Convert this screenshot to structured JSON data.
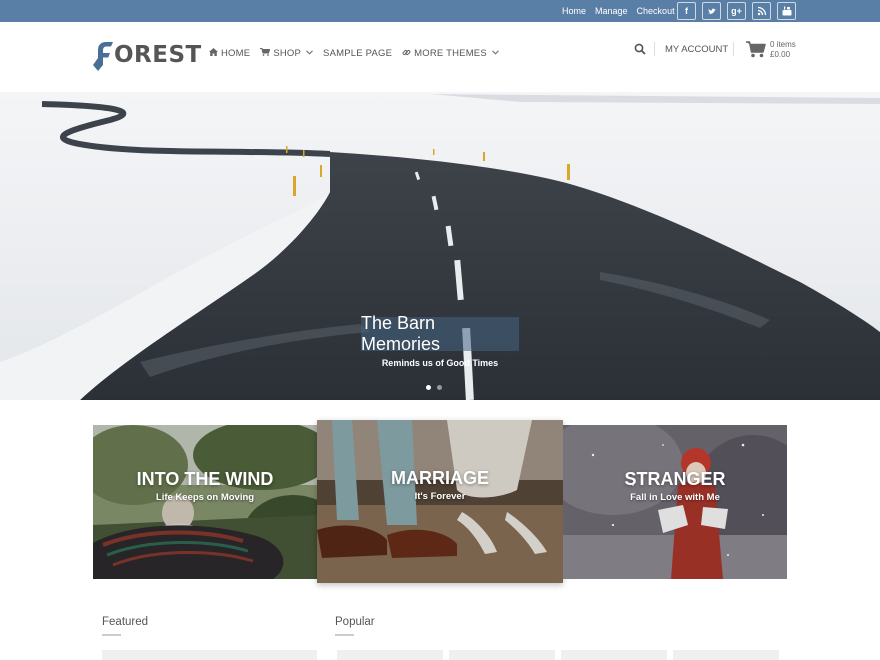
{
  "topbar": {
    "links": [
      "Home",
      "Manage",
      "Checkout"
    ],
    "socials": [
      {
        "icon": "facebook-icon",
        "glyph": "f"
      },
      {
        "icon": "twitter-icon",
        "glyph": "t"
      },
      {
        "icon": "google-plus-icon",
        "glyph": "g+"
      },
      {
        "icon": "rss-icon",
        "glyph": "◥"
      },
      {
        "icon": "youtube-icon",
        "glyph": "▶"
      }
    ],
    "bg_color": "#5a7fa6"
  },
  "header": {
    "logo_text": "OREST",
    "logo_accent": "#4a6f97",
    "nav": [
      {
        "label": "HOME",
        "icon": "home-icon",
        "glyph": "⌂",
        "caret": false
      },
      {
        "label": "SHOP",
        "icon": "cart-icon",
        "glyph": "☱",
        "caret": true
      },
      {
        "label": "SAMPLE PAGE",
        "icon": "",
        "glyph": "",
        "caret": false
      },
      {
        "label": "MORE THEMES",
        "icon": "link-icon",
        "glyph": "∞",
        "caret": true
      }
    ],
    "account_label": "MY ACCOUNT",
    "cart_items": "0 items",
    "cart_total": "£0.00"
  },
  "hero": {
    "title": "The Barn Memories",
    "subtitle": "Reminds us of Good Times",
    "slides": 2,
    "active_slide": 0
  },
  "cards": [
    {
      "title": "INTO THE WIND",
      "subtitle": "Life Keeps on Moving"
    },
    {
      "title": "MARRIAGE",
      "subtitle": "It's Forever"
    },
    {
      "title": "STRANGER",
      "subtitle": "Fall in Love with Me"
    }
  ],
  "sections": {
    "featured": "Featured",
    "popular": "Popular"
  }
}
